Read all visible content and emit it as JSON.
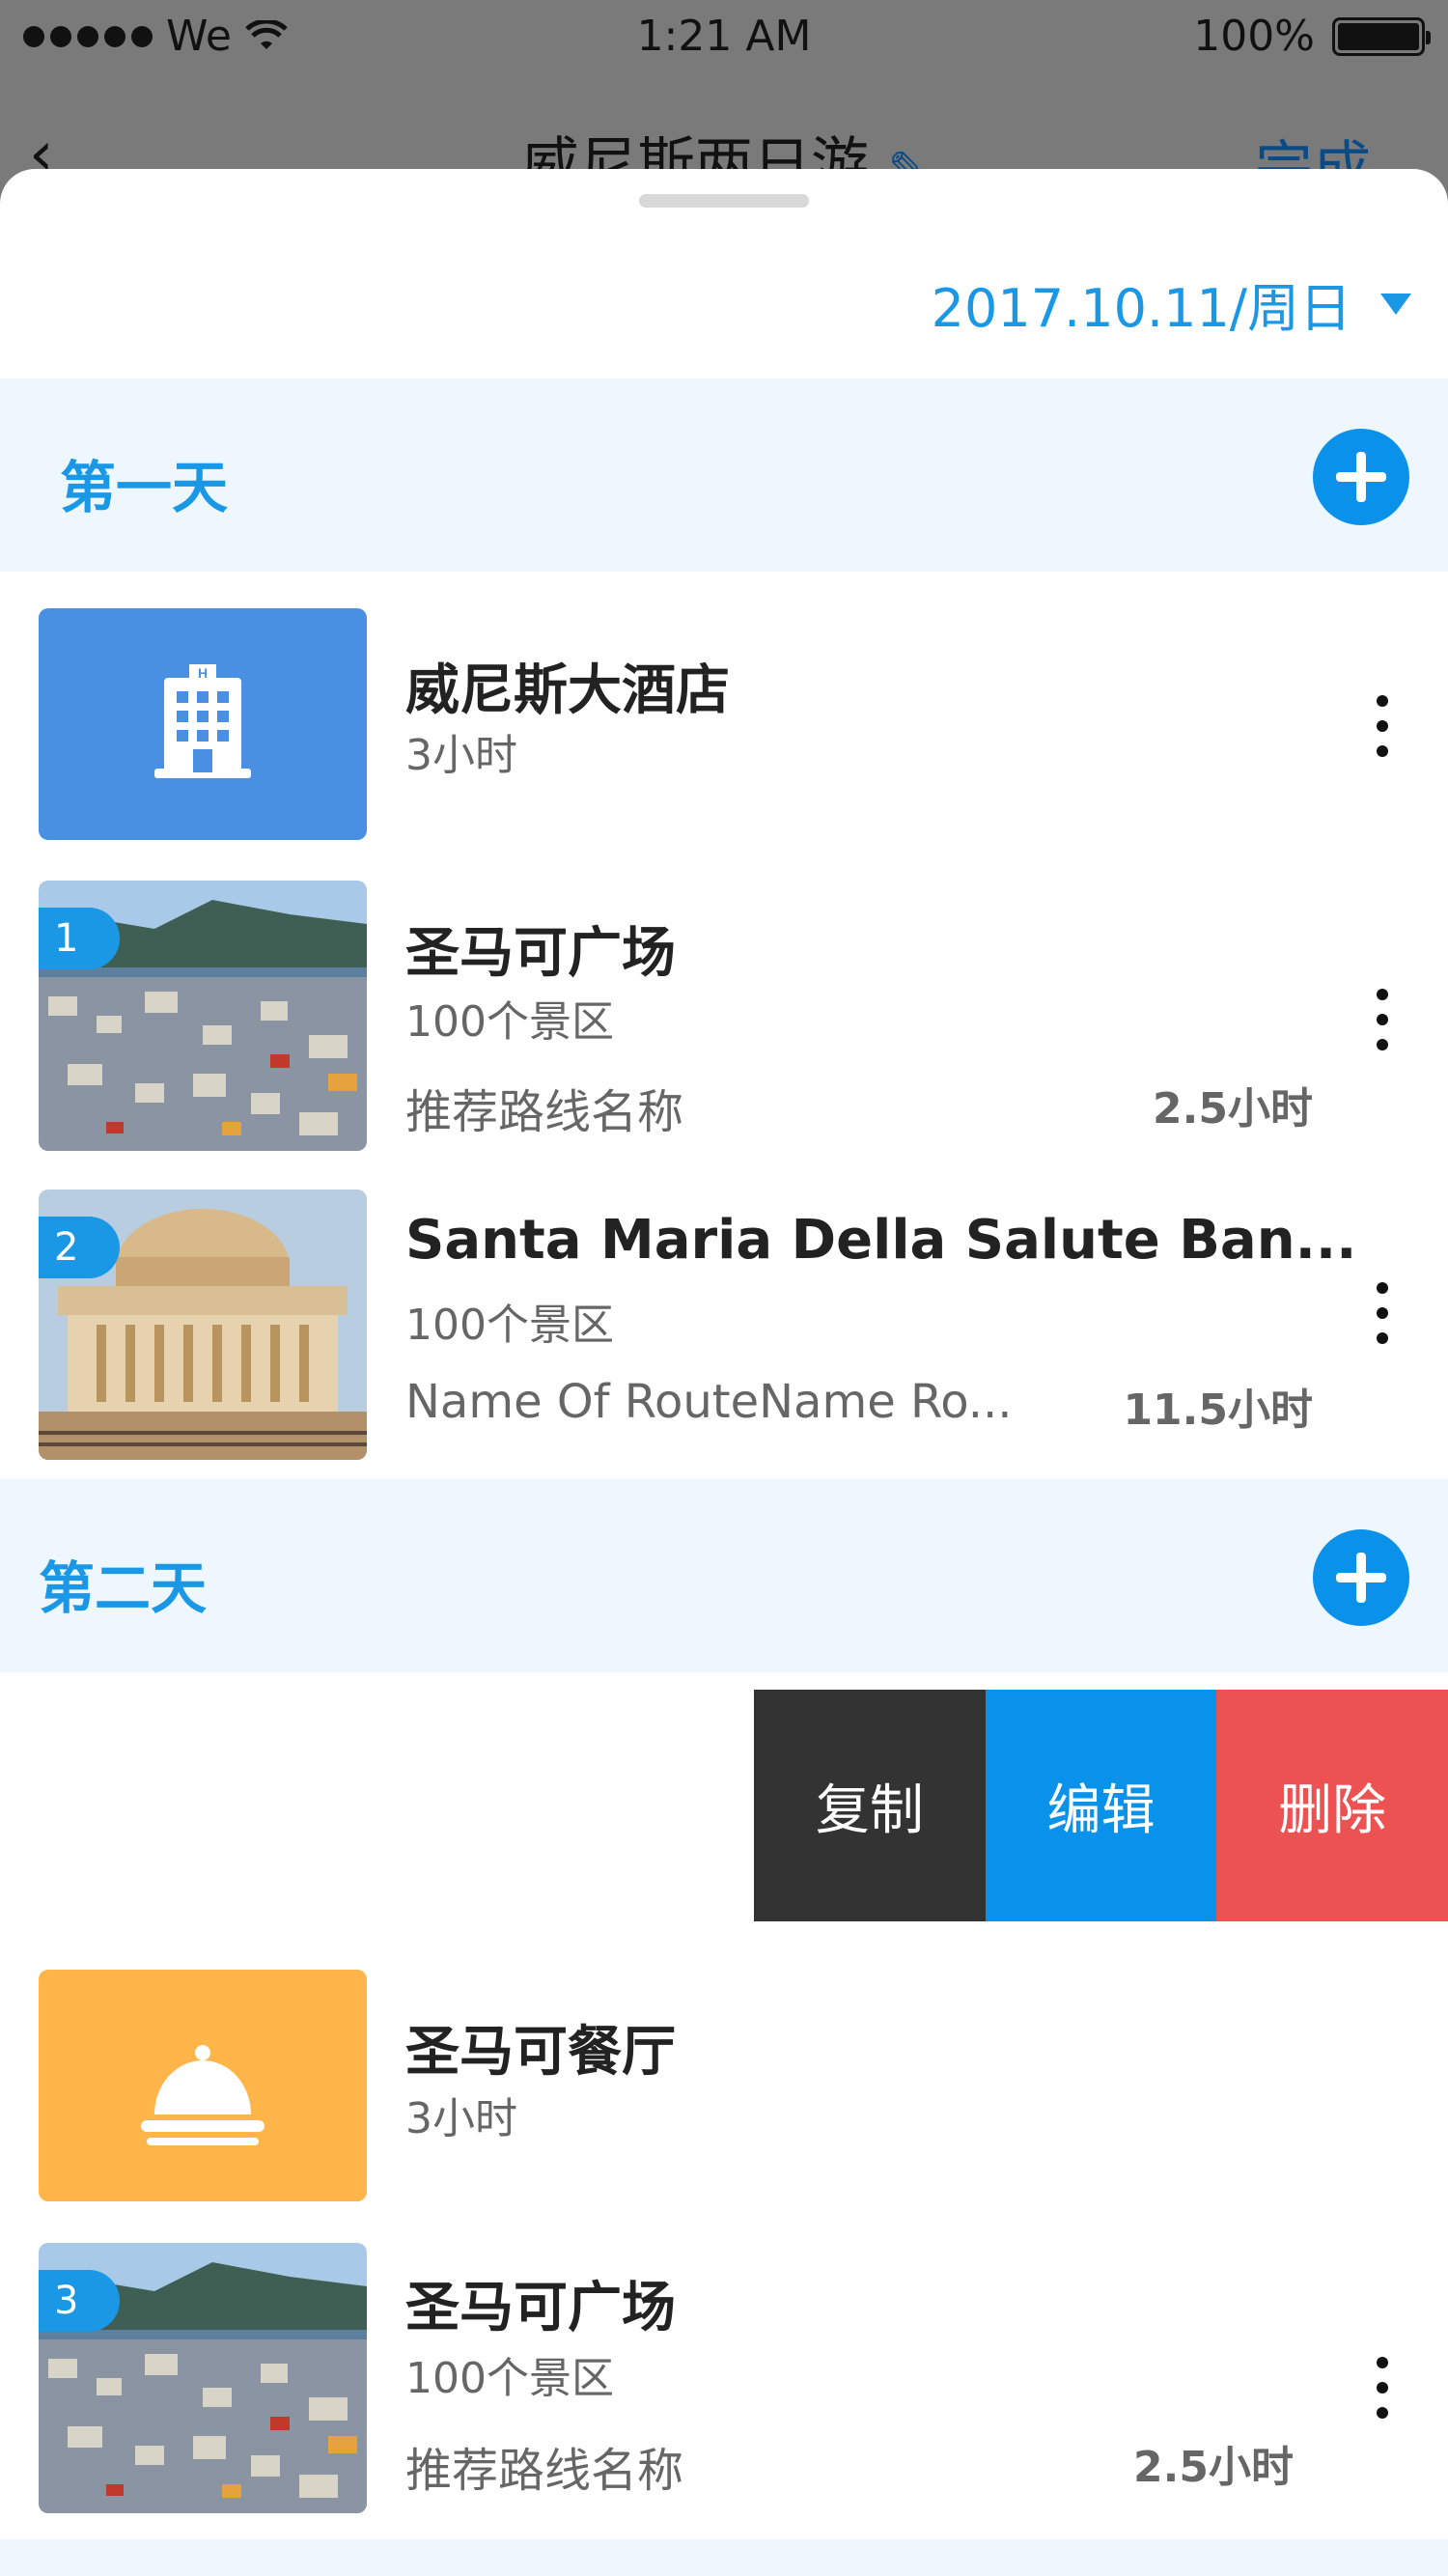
{
  "status_bar": {
    "carrier": "We",
    "time": "1:21 AM",
    "battery": "100%"
  },
  "nav": {
    "back_icon": "chevron-left-icon",
    "title": "威尼斯两日游",
    "edit_icon": "pencil-icon",
    "done": "完成"
  },
  "date_selector": {
    "value": "2017.10.11/周日"
  },
  "days": [
    {
      "label": "第一天",
      "items": [
        {
          "type": "hotel",
          "icon": "hotel-icon",
          "title": "威尼斯大酒店",
          "subtitle": "3小时"
        },
        {
          "type": "spot",
          "index": "1",
          "title": "圣马可广场",
          "subtitle": "100个景区",
          "route": "推荐路线名称",
          "duration": "2.5小时"
        },
        {
          "type": "spot",
          "index": "2",
          "title": "Santa Maria Della Salute Ban...",
          "subtitle": "100个景区",
          "route": "Name Of RouteName  Ro...",
          "duration": "11.5小时"
        }
      ]
    },
    {
      "label": "第二天",
      "swipe_actions": [
        "复制",
        "编辑",
        "删除"
      ],
      "items": [
        {
          "type": "restaurant",
          "icon": "food-cloche-icon",
          "title": "圣马可餐厅",
          "subtitle": "3小时"
        },
        {
          "type": "spot",
          "index": "3",
          "title": "圣马可广场",
          "subtitle": "100个景区",
          "route": "推荐路线名称",
          "duration": "2.5小时"
        }
      ]
    }
  ],
  "colors": {
    "accent": "#1a98e6",
    "day_band": "#eef7fd",
    "hotel_tile": "#4a90e2",
    "food_tile": "#ffb549",
    "copy_action": "#333333",
    "edit_action": "#0a92ea",
    "delete_action": "#ec5251"
  }
}
